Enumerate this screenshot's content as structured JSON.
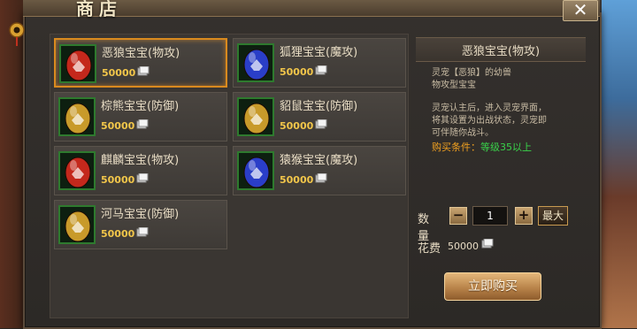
{
  "window": {
    "title": "商店",
    "close_symbol": "✕"
  },
  "items": [
    {
      "name": "恶狼宝宝(物攻)",
      "price": "50000",
      "egg": "red",
      "selected": true
    },
    {
      "name": "狐狸宝宝(魔攻)",
      "price": "50000",
      "egg": "blue",
      "selected": false
    },
    {
      "name": "棕熊宝宝(防御)",
      "price": "50000",
      "egg": "gold",
      "selected": false
    },
    {
      "name": "貂鼠宝宝(防御)",
      "price": "50000",
      "egg": "gold",
      "selected": false
    },
    {
      "name": "麒麟宝宝(物攻)",
      "price": "50000",
      "egg": "red",
      "selected": false
    },
    {
      "name": "猿猴宝宝(魔攻)",
      "price": "50000",
      "egg": "blue",
      "selected": false
    },
    {
      "name": "河马宝宝(防御)",
      "price": "50000",
      "egg": "gold",
      "selected": false
    }
  ],
  "detail": {
    "title": "恶狼宝宝(物攻)",
    "desc_line1": "灵宠【恶狼】的幼兽",
    "desc_line2": "物攻型宝宝",
    "desc_line3": "灵宠认主后，进入灵宠界面，",
    "desc_line4": "将其设置为出战状态，灵宠即",
    "desc_line5": "可伴随你战斗。",
    "buy_condition_label": "购买条件：",
    "buy_condition_value": "等级35以上"
  },
  "purchase": {
    "qty_label": "数量",
    "minus": "−",
    "qty": "1",
    "plus": "+",
    "max_label": "最大",
    "cost_label": "花费",
    "cost_value": "50000",
    "buy_label": "立即购买"
  },
  "colors": {
    "egg_red": "#c4281c",
    "egg_blue": "#2a3ec8",
    "egg_gold": "#c89a2a",
    "price": "#f2c64a",
    "selected_border": "#d98a1e",
    "condition_value": "#39d24a"
  }
}
